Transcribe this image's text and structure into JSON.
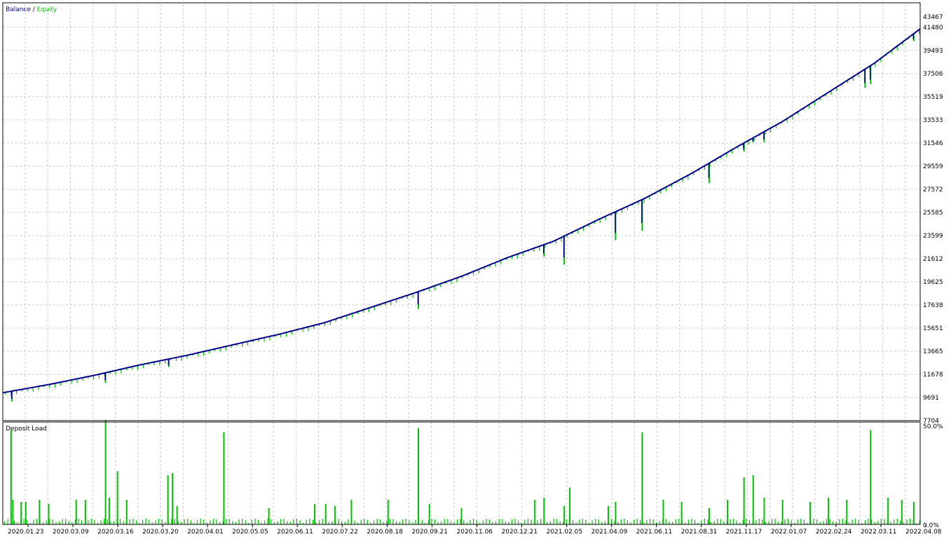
{
  "legend": {
    "balance_label": "Balance",
    "separator": " / ",
    "equity_label": "Equity"
  },
  "subpanel": {
    "title": "Deposit Load"
  },
  "colors": {
    "balance": "#00008b",
    "equity": "#00c000",
    "deposit_load": "#00c000",
    "grid": "#c8c8c8",
    "frame": "#000000",
    "background": "#ffffff"
  },
  "chart_data": [
    {
      "type": "line",
      "panel": "main",
      "grid": true,
      "legend_position": "top-left",
      "yaxis_position": "right",
      "ylim": [
        7704,
        43467
      ],
      "y_ticks": [
        "43467",
        "41480",
        "39493",
        "37506",
        "35519",
        "33533",
        "31546",
        "29559",
        "27572",
        "25585",
        "23599",
        "21612",
        "19625",
        "17638",
        "15651",
        "13665",
        "11678",
        "9691",
        "7704"
      ],
      "x_ticks": [
        "2020.01.23",
        "2020.03.09",
        "2020.03.16",
        "2020.03.20",
        "2020.04.01",
        "2020.05.05",
        "2020.06.11",
        "2020.07.22",
        "2020.08.18",
        "2020.09.21",
        "2020.11.06",
        "2020.12.21",
        "2021.02.05",
        "2021.04.09",
        "2021.06.11",
        "2021.08.31",
        "2021.11.17",
        "2022.01.07",
        "2022.02.24",
        "2022.03.11",
        "2022.04.08"
      ],
      "series": [
        {
          "name": "Balance",
          "x": [
            0,
            0.05,
            0.1,
            0.15,
            0.2,
            0.25,
            0.3,
            0.35,
            0.4,
            0.45,
            0.5,
            0.55,
            0.6,
            0.65,
            0.7,
            0.75,
            0.8,
            0.85,
            0.9,
            0.95,
            1.0
          ],
          "values": [
            10100,
            10800,
            11600,
            12500,
            13300,
            14200,
            15100,
            16100,
            17400,
            18700,
            20100,
            21700,
            23100,
            25000,
            26800,
            28900,
            31200,
            33400,
            35900,
            38400,
            41350
          ]
        },
        {
          "name": "Equity",
          "x": [
            0.01,
            0.112,
            0.181,
            0.241,
            0.453,
            0.59,
            0.612,
            0.668,
            0.697,
            0.77,
            0.808,
            0.818,
            0.83,
            0.94,
            0.946,
            0.993
          ],
          "values": [
            9350,
            10950,
            12300,
            14100,
            17300,
            21800,
            21100,
            23200,
            24000,
            28100,
            30800,
            31600,
            31600,
            36300,
            36600,
            40300
          ]
        }
      ]
    },
    {
      "type": "bar",
      "panel": "sub",
      "title": "Deposit Load",
      "ylim": [
        0,
        50
      ],
      "y_ticks": [
        "50.0%",
        "0.0%"
      ],
      "spike_x": [
        0.009,
        0.011,
        0.02,
        0.025,
        0.04,
        0.05,
        0.08,
        0.09,
        0.112,
        0.116,
        0.125,
        0.135,
        0.18,
        0.185,
        0.19,
        0.241,
        0.29,
        0.34,
        0.352,
        0.362,
        0.38,
        0.42,
        0.453,
        0.465,
        0.5,
        0.58,
        0.59,
        0.612,
        0.618,
        0.66,
        0.668,
        0.697,
        0.72,
        0.74,
        0.77,
        0.79,
        0.808,
        0.818,
        0.83,
        0.85,
        0.88,
        0.9,
        0.92,
        0.946,
        0.965,
        0.98,
        0.993
      ],
      "spike_values": [
        46,
        12,
        11,
        11,
        12,
        10,
        12,
        12,
        51,
        13,
        26,
        12,
        24,
        25,
        9,
        45,
        8,
        10,
        10,
        9,
        12,
        12,
        47,
        10,
        8,
        12,
        13,
        9,
        18,
        9,
        11,
        45,
        12,
        11,
        8,
        12,
        23,
        24,
        13,
        12,
        11,
        13,
        12,
        46,
        13,
        12,
        11
      ]
    }
  ]
}
